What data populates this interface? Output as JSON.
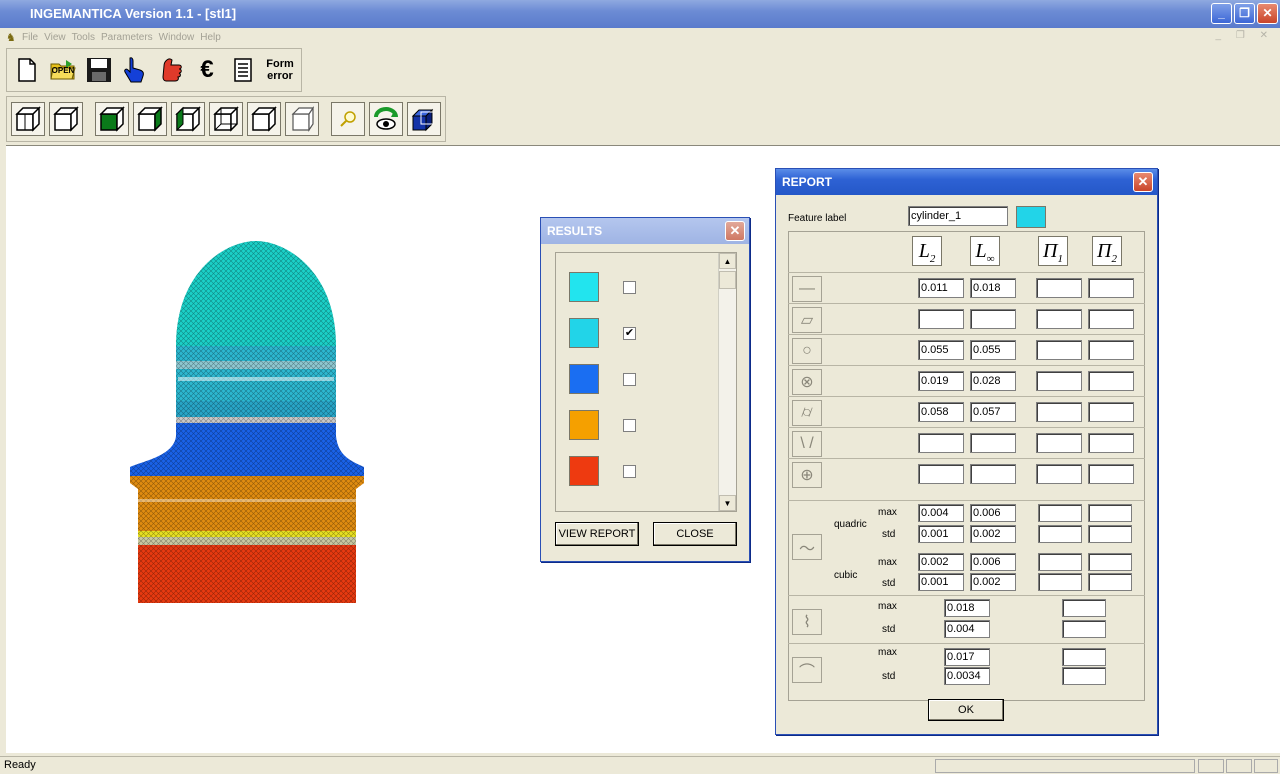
{
  "window": {
    "title": "INGEMANTICA Version 1.1 - [stl1]",
    "minimize_glyph": "_",
    "restore_glyph": "❐",
    "close_glyph": "✕"
  },
  "menu": {
    "items": [
      "File",
      "View",
      "Tools",
      "Parameters",
      "Window",
      "Help"
    ],
    "mdi_controls": "_ ❐ ✕"
  },
  "toolbar1": {
    "new_icon": "new-document-icon",
    "open_label": "OPEN",
    "save_icon": "save-icon",
    "euro_glyph": "€",
    "form_error_label_1": "Form",
    "form_error_label_2": "error"
  },
  "status": {
    "text": "Ready"
  },
  "results": {
    "title": "RESULTS",
    "close_glyph": "✕",
    "items": [
      {
        "color": "#22e4ee",
        "checked": false
      },
      {
        "color": "#22d4e8",
        "checked": true
      },
      {
        "color": "#1a6ef2",
        "checked": false
      },
      {
        "color": "#f5a000",
        "checked": false
      },
      {
        "color": "#ee3a10",
        "checked": false
      }
    ],
    "check_mark": "✔",
    "view_report_label": "VIEW REPORT",
    "close_label": "CLOSE"
  },
  "report": {
    "title": "REPORT",
    "close_glyph": "✕",
    "feature_label": "Feature label",
    "feature_value": "cylinder_1",
    "feature_color": "#22d4e8",
    "headers": {
      "L": "L",
      "sub2": "2",
      "subinf": "∞",
      "P": "Π",
      "sub1": "1"
    },
    "rows": [
      {
        "icon": "line-icon",
        "l2": "0.011",
        "linf": "0.018"
      },
      {
        "icon": "plane-icon",
        "l2": "",
        "linf": ""
      },
      {
        "icon": "circle-icon",
        "l2": "0.055",
        "linf": "0.055"
      },
      {
        "icon": "cylindricity-icon",
        "l2": "0.019",
        "linf": "0.028"
      },
      {
        "icon": "cylinder-icon",
        "l2": "0.058",
        "linf": "0.057"
      },
      {
        "icon": "cone-icon",
        "l2": "",
        "linf": ""
      },
      {
        "icon": "sphere-icon",
        "l2": "",
        "linf": ""
      }
    ],
    "curve": {
      "quadric_label": "quadric",
      "cubic_label": "cubic",
      "max_label": "max",
      "std_label": "std",
      "quadric_max": [
        "0.004",
        "0.006"
      ],
      "quadric_std": [
        "0.001",
        "0.002"
      ],
      "cubic_max": [
        "0.002",
        "0.006"
      ],
      "cubic_std": [
        "0.001",
        "0.002"
      ]
    },
    "profile1": {
      "max": "0.018",
      "std": "0.004"
    },
    "profile2": {
      "max": "0.017",
      "std": "0.0034"
    },
    "ok_label": "OK"
  }
}
